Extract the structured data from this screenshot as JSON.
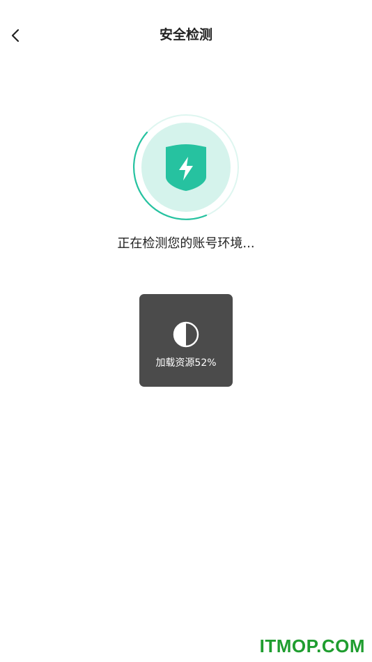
{
  "header": {
    "title": "安全检测",
    "back_icon": "chevron-left-icon"
  },
  "scan": {
    "shield_icon": "shield-bolt-icon",
    "accent_color": "#26c2a0",
    "light_color": "#d5f3ec",
    "status_text": "正在检测您的账号环境..."
  },
  "toast": {
    "icon": "half-circle-loading-icon",
    "text": "加载资源52%",
    "progress_percent": 52
  },
  "watermark": {
    "text": "ITMOP.COM"
  }
}
